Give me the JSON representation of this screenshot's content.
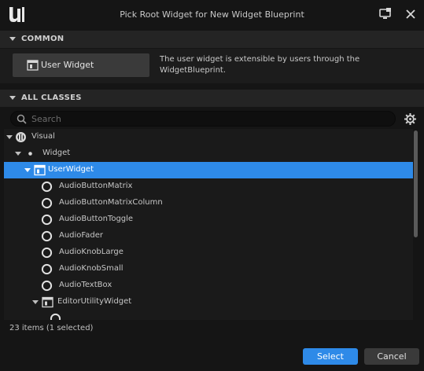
{
  "window": {
    "title": "Pick Root Widget for New Widget Blueprint",
    "logo_icon": "unreal-engine-logo",
    "monitor_icon": "monitor-icon",
    "close_icon": "close-icon"
  },
  "common": {
    "header": "COMMON",
    "button_label": "User Widget",
    "description": "The user widget is extensible by users through the WidgetBlueprint."
  },
  "all_classes": {
    "header": "ALL CLASSES",
    "search_placeholder": "Search",
    "tree": [
      {
        "label": "Visual",
        "icon": "visual-icon",
        "expanded": true
      },
      {
        "label": "Widget",
        "icon": "dot-icon",
        "expanded": true
      },
      {
        "label": "UserWidget",
        "icon": "user-widget-icon",
        "expanded": true,
        "selected": true
      },
      {
        "label": "AudioButtonMatrix",
        "icon": "circle-icon"
      },
      {
        "label": "AudioButtonMatrixColumn",
        "icon": "circle-icon"
      },
      {
        "label": "AudioButtonToggle",
        "icon": "circle-icon"
      },
      {
        "label": "AudioFader",
        "icon": "circle-icon"
      },
      {
        "label": "AudioKnobLarge",
        "icon": "circle-icon"
      },
      {
        "label": "AudioKnobSmall",
        "icon": "circle-icon"
      },
      {
        "label": "AudioTextBox",
        "icon": "circle-icon"
      },
      {
        "label": "EditorUtilityWidget",
        "icon": "user-widget-icon",
        "expanded": true
      },
      {
        "label": "",
        "icon": "circle-icon"
      }
    ]
  },
  "status": "23 items (1 selected)",
  "buttons": {
    "select": "Select",
    "cancel": "Cancel"
  },
  "colors": {
    "accent": "#2e8ae8",
    "background": "#151515",
    "panel": "#1a1a1a"
  }
}
